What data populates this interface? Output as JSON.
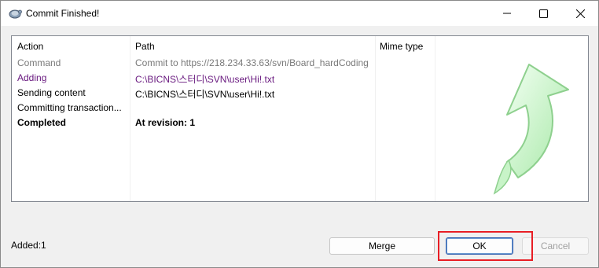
{
  "window": {
    "title": "Commit Finished!",
    "minimize_icon": "minimize-icon",
    "maximize_icon": "maximize-icon",
    "close_icon": "close-icon"
  },
  "table": {
    "columns": [
      "Action",
      "Path",
      "Mime type"
    ],
    "rows": [
      {
        "action": "Command",
        "path": "Commit to https://218.234.33.63/svn/Board_hardCoding",
        "style": "gray"
      },
      {
        "action": "Adding",
        "path": "C:\\BICNS\\스터디\\SVN\\user\\Hi!.txt",
        "style": "purple"
      },
      {
        "action": "Sending content",
        "path": "C:\\BICNS\\스터디\\SVN\\user\\Hi!.txt",
        "style": "normal"
      },
      {
        "action": "Committing transaction...",
        "path": "",
        "style": "normal"
      },
      {
        "action": "Completed",
        "path": "At revision: 1",
        "style": "bold"
      }
    ]
  },
  "status": {
    "text": "Added:1"
  },
  "buttons": {
    "merge": "Merge",
    "ok": "OK",
    "cancel": "Cancel"
  },
  "colors": {
    "added_purple": "#6a1b80",
    "highlight_red": "#e81e25",
    "arrow_green": "#b8f0b8"
  }
}
